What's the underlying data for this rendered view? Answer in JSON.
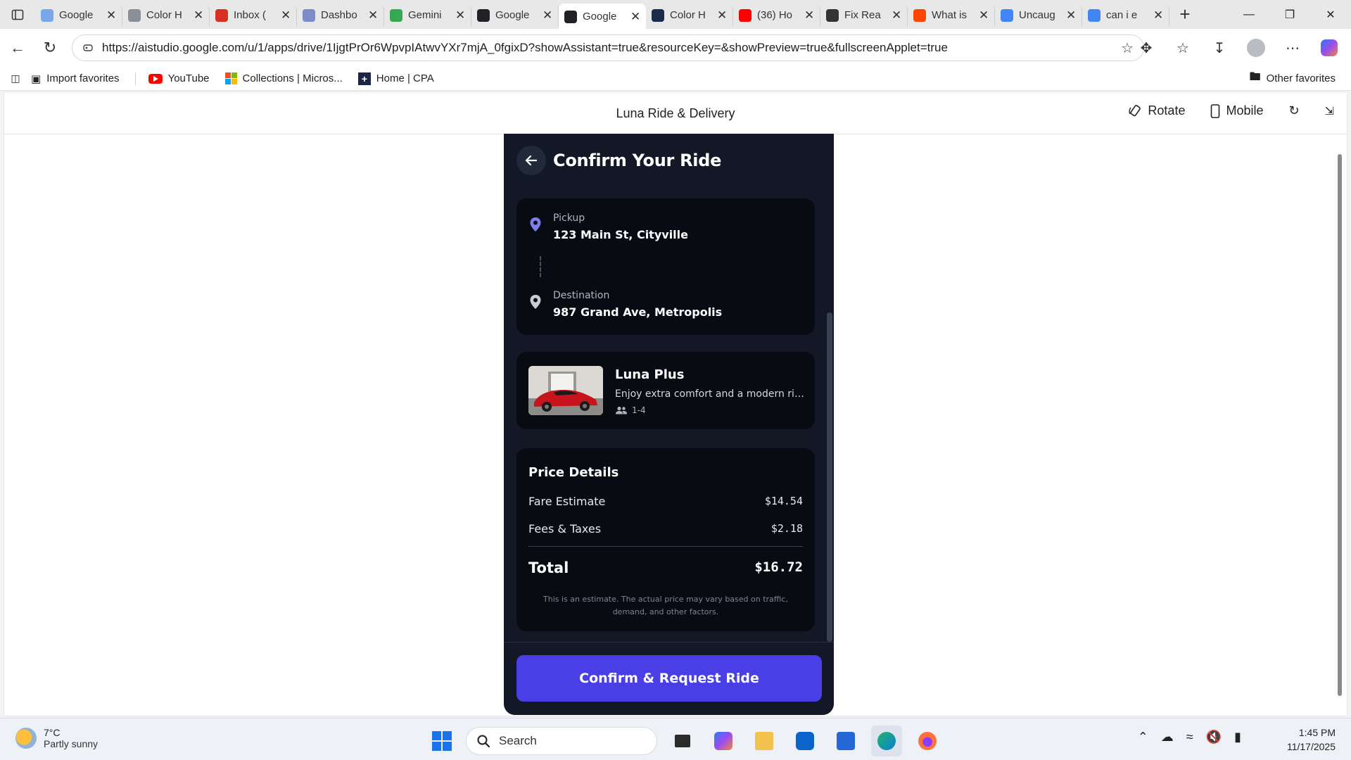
{
  "browser": {
    "tabs": [
      {
        "title": "Google",
        "favicon": "google-doc-icon",
        "color": "#7aa7e9"
      },
      {
        "title": "Color H",
        "favicon": "d-logo-icon",
        "color": "#8a8f99"
      },
      {
        "title": "Inbox (",
        "favicon": "gmail-icon",
        "color": "#d93025"
      },
      {
        "title": "Dashbo",
        "favicon": "dashboard-icon",
        "color": "#7b8cc9"
      },
      {
        "title": "Gemini",
        "favicon": "drive-icon",
        "color": "#34a853"
      },
      {
        "title": "Google",
        "favicon": "aistudio-icon",
        "color": "#202124"
      },
      {
        "title": "Google",
        "favicon": "aistudio-icon",
        "color": "#202124"
      },
      {
        "title": "Color H",
        "favicon": "d-logo-icon",
        "color": "#1b2b4a"
      },
      {
        "title": "(36) Ho",
        "favicon": "youtube-icon",
        "color": "#ff0000"
      },
      {
        "title": "Fix Rea",
        "favicon": "openai-icon",
        "color": "#333333"
      },
      {
        "title": "What is",
        "favicon": "reddit-icon",
        "color": "#ff4500"
      },
      {
        "title": "Uncaug",
        "favicon": "google-icon",
        "color": "#4285f4"
      },
      {
        "title": "can i e",
        "favicon": "google-icon",
        "color": "#4285f4"
      }
    ],
    "active_tab_index": 6,
    "url": "https://aistudio.google.com/u/1/apps/drive/1IjgtPrOr6WpvpIAtwvYXr7mjA_0fgixD?showAssistant=true&resourceKey=&showPreview=true&fullscreenApplet=true",
    "favorites": [
      {
        "label": "Import favorites",
        "icon": "import-icon"
      },
      {
        "label": "YouTube",
        "icon": "youtube-icon"
      },
      {
        "label": "Collections | Micros...",
        "icon": "microsoft-icon"
      },
      {
        "label": "Home | CPA",
        "icon": "cpa-icon"
      }
    ],
    "other_favorites": "Other favorites"
  },
  "app_header": {
    "title": "Luna Ride & Delivery",
    "rotate_label": "Rotate",
    "mobile_label": "Mobile"
  },
  "screen": {
    "title": "Confirm Your Ride",
    "pickup": {
      "label": "Pickup",
      "address": "123 Main St, Cityville"
    },
    "destination": {
      "label": "Destination",
      "address": "987 Grand Ave, Metropolis"
    },
    "ride": {
      "name": "Luna Plus",
      "description": "Enjoy extra comfort and a modern ride...",
      "capacity": "1-4"
    },
    "price": {
      "title": "Price Details",
      "rows": [
        {
          "label": "Fare Estimate",
          "value": "$14.54"
        },
        {
          "label": "Fees & Taxes",
          "value": "$2.18"
        }
      ],
      "total_label": "Total",
      "total_value": "$16.72",
      "note": "This is an estimate. The actual price may vary based on traffic, demand, and other factors."
    },
    "cta_label": "Confirm & Request Ride",
    "colors": {
      "background": "#121826",
      "card": "#080b12",
      "accent": "#4a3ee6",
      "pickup_pin": "#7b7ff0",
      "destination_pin": "#c9ccd4"
    }
  },
  "taskbar": {
    "temperature": "7°C",
    "weather": "Partly sunny",
    "search_placeholder": "Search",
    "time": "1:45 PM",
    "date": "11/17/2025"
  }
}
